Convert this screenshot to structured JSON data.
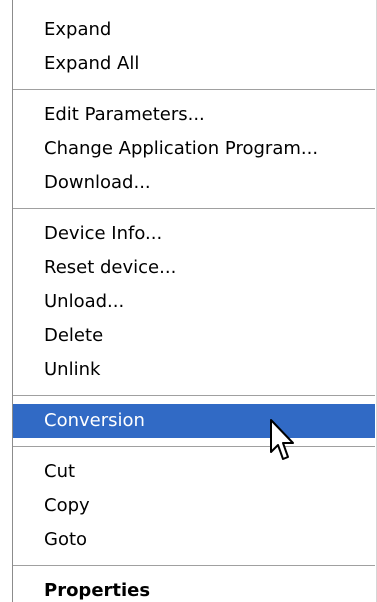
{
  "menu": {
    "items": [
      {
        "label": "Expand"
      },
      {
        "label": "Expand All"
      },
      {
        "label": "Edit Parameters..."
      },
      {
        "label": "Change Application Program..."
      },
      {
        "label": "Download..."
      },
      {
        "label": "Device Info..."
      },
      {
        "label": "Reset device..."
      },
      {
        "label": "Unload..."
      },
      {
        "label": "Delete"
      },
      {
        "label": "Unlink"
      },
      {
        "label": "Conversion",
        "highlighted": true
      },
      {
        "label": "Cut"
      },
      {
        "label": "Copy"
      },
      {
        "label": "Goto"
      },
      {
        "label": "Properties",
        "bold": true
      }
    ]
  },
  "cursor": {
    "icon": "arrow-pointer-icon"
  },
  "colors": {
    "highlight_bg": "#316ac5",
    "highlight_text": "#ffffff",
    "separator": "#a0a0a0"
  }
}
